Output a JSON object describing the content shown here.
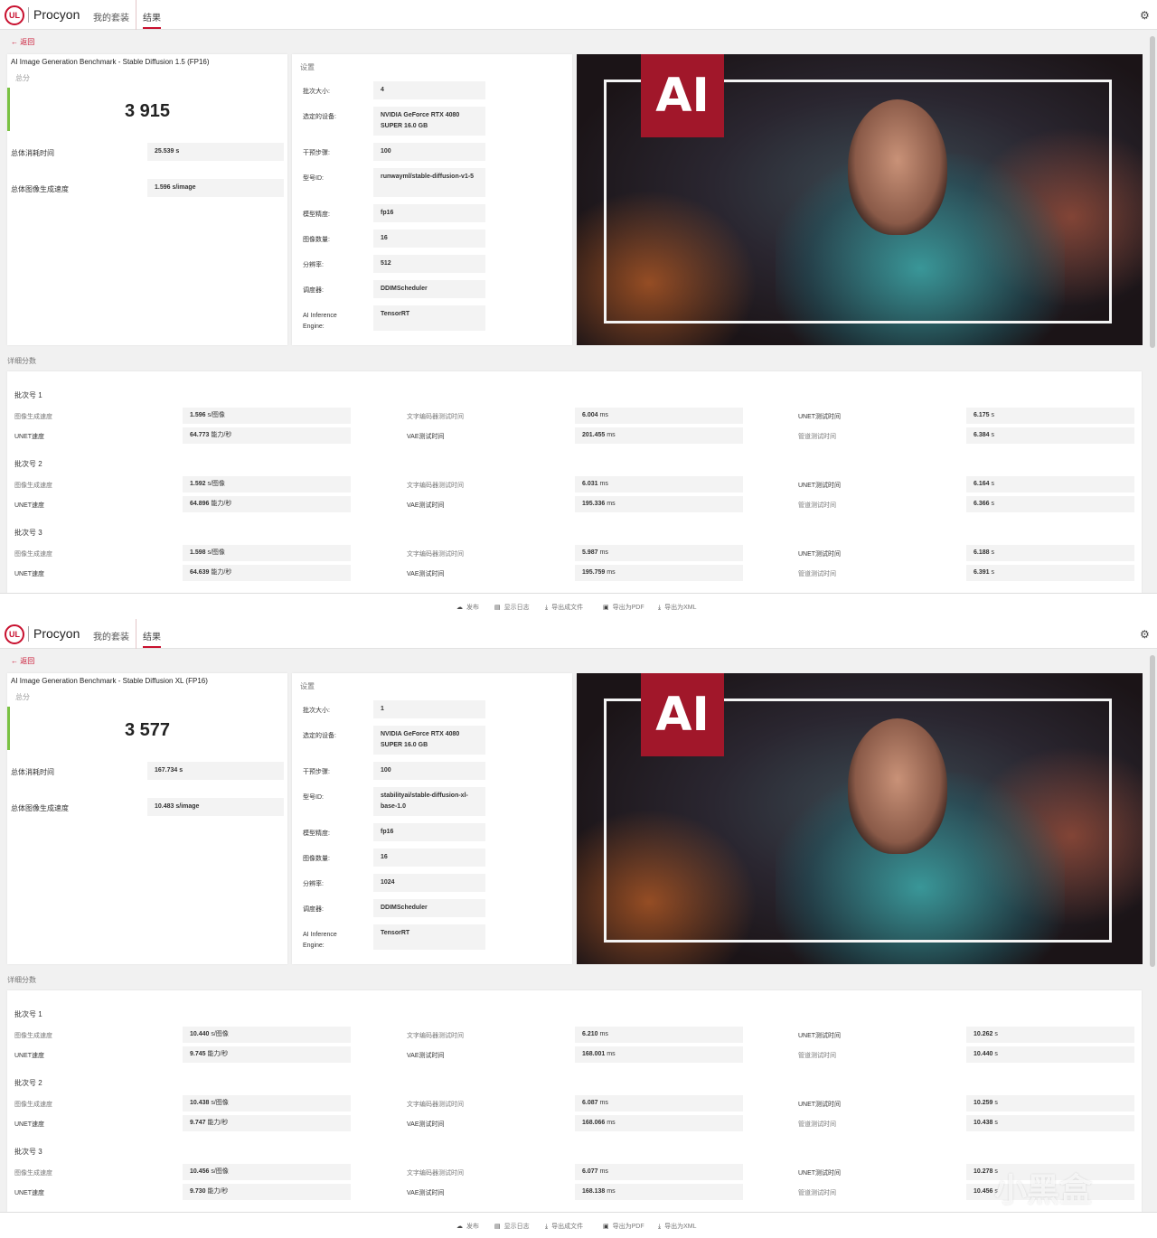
{
  "app": {
    "brand": "Procyon",
    "logo": "UL",
    "tabs": [
      "我的套装",
      "结果"
    ],
    "active_tab": 1,
    "back": "返回",
    "accent": "#c8102e",
    "score_bar_color": "#7ac143"
  },
  "panels": [
    {
      "title": "AI Image Generation Benchmark - Stable Diffusion 1.5 (FP16)",
      "score_label": "总分",
      "score": "3 915",
      "summary": [
        {
          "label": "总体消耗时间",
          "value": "25.539 s"
        },
        {
          "label": "总体图像生成速度",
          "value": "1.596 s/image"
        }
      ],
      "settings_title": "设置",
      "settings": [
        {
          "label": "批次大小:",
          "value": "4"
        },
        {
          "label": "选定的设备:",
          "value": "NVIDIA GeForce RTX 4080 SUPER 16.0 GB"
        },
        {
          "label": "干预步骤:",
          "value": "100"
        },
        {
          "label": "型号ID:",
          "value": "runwayml/stable-diffusion-v1-5"
        },
        {
          "label": "模型精度:",
          "value": "fp16"
        },
        {
          "label": "图像数量:",
          "value": "16"
        },
        {
          "label": "分辨率:",
          "value": "512"
        },
        {
          "label": "调度器:",
          "value": "DDIMScheduler"
        },
        {
          "label": "AI Inference Engine:",
          "value": "TensorRT"
        }
      ],
      "hero_logo": "AI",
      "detail_title": "详细分数",
      "batches": [
        {
          "heading": "批次号 1",
          "rows": [
            [
              {
                "label": "图像生成速度",
                "value": "1.596",
                "unit": "s/图像"
              },
              {
                "label": "文字编码器测试时间",
                "value": "6.004",
                "unit": "ms"
              },
              {
                "label": "UNET测试时间",
                "value": "6.175",
                "unit": "s"
              }
            ],
            [
              {
                "label": "UNET速度",
                "value": "64.773",
                "unit": "能力/秒"
              },
              {
                "label": "VAE测试时间",
                "value": "201.455",
                "unit": "ms"
              },
              {
                "label": "管道测试时间",
                "value": "6.384",
                "unit": "s"
              }
            ]
          ]
        },
        {
          "heading": "批次号 2",
          "rows": [
            [
              {
                "label": "图像生成速度",
                "value": "1.592",
                "unit": "s/图像"
              },
              {
                "label": "文字编码器测试时间",
                "value": "6.031",
                "unit": "ms"
              },
              {
                "label": "UNET测试时间",
                "value": "6.164",
                "unit": "s"
              }
            ],
            [
              {
                "label": "UNET速度",
                "value": "64.896",
                "unit": "能力/秒"
              },
              {
                "label": "VAE测试时间",
                "value": "195.336",
                "unit": "ms"
              },
              {
                "label": "管道测试时间",
                "value": "6.366",
                "unit": "s"
              }
            ]
          ]
        },
        {
          "heading": "批次号 3",
          "rows": [
            [
              {
                "label": "图像生成速度",
                "value": "1.598",
                "unit": "s/图像"
              },
              {
                "label": "文字编码器测试时间",
                "value": "5.987",
                "unit": "ms"
              },
              {
                "label": "UNET测试时间",
                "value": "6.188",
                "unit": "s"
              }
            ],
            [
              {
                "label": "UNET速度",
                "value": "64.639",
                "unit": "能力/秒"
              },
              {
                "label": "VAE测试时间",
                "value": "195.759",
                "unit": "ms"
              },
              {
                "label": "管道测试时间",
                "value": "6.391",
                "unit": "s"
              }
            ]
          ]
        }
      ]
    },
    {
      "title": "AI Image Generation Benchmark - Stable Diffusion XL (FP16)",
      "score_label": "总分",
      "score": "3 577",
      "summary": [
        {
          "label": "总体消耗时间",
          "value": "167.734 s"
        },
        {
          "label": "总体图像生成速度",
          "value": "10.483 s/image"
        }
      ],
      "settings_title": "设置",
      "settings": [
        {
          "label": "批次大小:",
          "value": "1"
        },
        {
          "label": "选定的设备:",
          "value": "NVIDIA GeForce RTX 4080 SUPER 16.0 GB"
        },
        {
          "label": "干预步骤:",
          "value": "100"
        },
        {
          "label": "型号ID:",
          "value": "stabilityai/stable-diffusion-xl-base-1.0"
        },
        {
          "label": "模型精度:",
          "value": "fp16"
        },
        {
          "label": "图像数量:",
          "value": "16"
        },
        {
          "label": "分辨率:",
          "value": "1024"
        },
        {
          "label": "调度器:",
          "value": "DDIMScheduler"
        },
        {
          "label": "AI Inference Engine:",
          "value": "TensorRT"
        }
      ],
      "hero_logo": "AI",
      "detail_title": "详细分数",
      "batches": [
        {
          "heading": "批次号 1",
          "rows": [
            [
              {
                "label": "图像生成速度",
                "value": "10.440",
                "unit": "s/图像"
              },
              {
                "label": "文字编码器测试时间",
                "value": "6.210",
                "unit": "ms"
              },
              {
                "label": "UNET测试时间",
                "value": "10.262",
                "unit": "s"
              }
            ],
            [
              {
                "label": "UNET速度",
                "value": "9.745",
                "unit": "能力/秒"
              },
              {
                "label": "VAE测试时间",
                "value": "168.001",
                "unit": "ms"
              },
              {
                "label": "管道测试时间",
                "value": "10.440",
                "unit": "s"
              }
            ]
          ]
        },
        {
          "heading": "批次号 2",
          "rows": [
            [
              {
                "label": "图像生成速度",
                "value": "10.438",
                "unit": "s/图像"
              },
              {
                "label": "文字编码器测试时间",
                "value": "6.087",
                "unit": "ms"
              },
              {
                "label": "UNET测试时间",
                "value": "10.259",
                "unit": "s"
              }
            ],
            [
              {
                "label": "UNET速度",
                "value": "9.747",
                "unit": "能力/秒"
              },
              {
                "label": "VAE测试时间",
                "value": "168.066",
                "unit": "ms"
              },
              {
                "label": "管道测试时间",
                "value": "10.438",
                "unit": "s"
              }
            ]
          ]
        },
        {
          "heading": "批次号 3",
          "rows": [
            [
              {
                "label": "图像生成速度",
                "value": "10.456",
                "unit": "s/图像"
              },
              {
                "label": "文字编码器测试时间",
                "value": "6.077",
                "unit": "ms"
              },
              {
                "label": "UNET测试时间",
                "value": "10.278",
                "unit": "s"
              }
            ],
            [
              {
                "label": "UNET速度",
                "value": "9.730",
                "unit": "能力/秒"
              },
              {
                "label": "VAE测试时间",
                "value": "168.138",
                "unit": "ms"
              },
              {
                "label": "管道测试时间",
                "value": "10.456",
                "unit": "s"
              }
            ]
          ]
        }
      ]
    }
  ],
  "toolbar": [
    {
      "label": "发布",
      "icon": "cloud-upload-icon"
    },
    {
      "label": "显示日志",
      "icon": "file-icon"
    },
    {
      "label": "导出成文件",
      "icon": "download-icon"
    },
    {
      "label": "导出为PDF",
      "icon": "save-icon"
    },
    {
      "label": "导出为XML",
      "icon": "download-icon"
    }
  ],
  "watermark": "小黑盒"
}
